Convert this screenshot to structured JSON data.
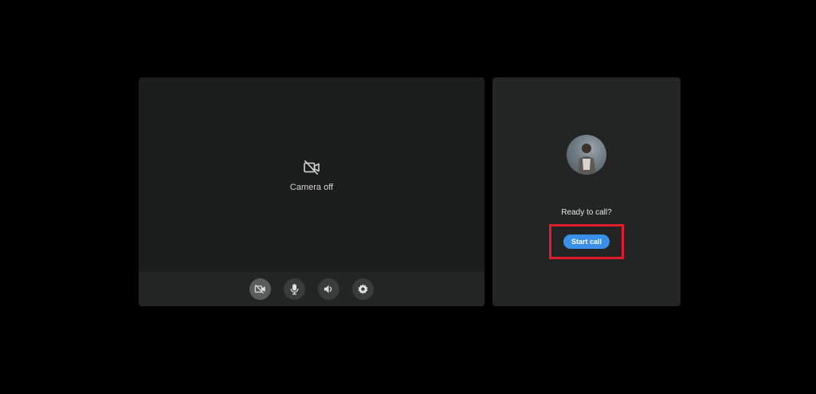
{
  "preview": {
    "camera_status": "Camera off",
    "icons": {
      "status": "video-off-icon"
    }
  },
  "controls": [
    {
      "name": "camera-toggle-button",
      "icon": "video-off-icon",
      "active": true
    },
    {
      "name": "microphone-button",
      "icon": "microphone-icon",
      "active": false
    },
    {
      "name": "speaker-button",
      "icon": "speaker-icon",
      "active": false
    },
    {
      "name": "settings-button",
      "icon": "gear-icon",
      "active": false
    }
  ],
  "call": {
    "prompt": "Ready to call?",
    "start_label": "Start call",
    "accent_color": "#3a8fe8",
    "highlight_color": "#e21b2c"
  }
}
